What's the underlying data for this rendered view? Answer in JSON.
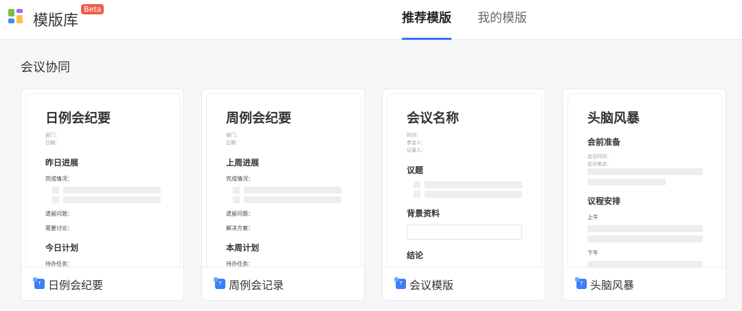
{
  "app": {
    "title": "模版库",
    "badge": "Beta"
  },
  "tabs": [
    {
      "label": "推荐模版",
      "active": true
    },
    {
      "label": "我的模版",
      "active": false
    }
  ],
  "section": {
    "title": "会议协同"
  },
  "colors": {
    "accent": "#3370ff",
    "badge": "#f25c4a"
  },
  "cards": [
    {
      "name": "日例会纪要",
      "blocks": [
        {
          "t": "title",
          "text": "日例会纪要"
        },
        {
          "t": "meta",
          "text": "部门："
        },
        {
          "t": "meta",
          "text": "日期："
        },
        {
          "t": "h2",
          "text": "昨日进展"
        },
        {
          "t": "label",
          "text": "完成情况："
        },
        {
          "t": "check"
        },
        {
          "t": "check"
        },
        {
          "t": "label",
          "text": "遗留问题："
        },
        {
          "t": "label",
          "text": "需要讨论："
        },
        {
          "t": "h2",
          "text": "今日计划"
        },
        {
          "t": "label",
          "text": "待办任务："
        }
      ]
    },
    {
      "name": "周例会记录",
      "blocks": [
        {
          "t": "title",
          "text": "周例会纪要"
        },
        {
          "t": "meta",
          "text": "部门："
        },
        {
          "t": "meta",
          "text": "日期："
        },
        {
          "t": "h2",
          "text": "上周进展"
        },
        {
          "t": "label",
          "text": "完成情况："
        },
        {
          "t": "check"
        },
        {
          "t": "check"
        },
        {
          "t": "label",
          "text": "遗留问题："
        },
        {
          "t": "label",
          "text": "解决方案："
        },
        {
          "t": "h2",
          "text": "本周计划"
        },
        {
          "t": "label",
          "text": "待办任务："
        }
      ]
    },
    {
      "name": "会议模版",
      "blocks": [
        {
          "t": "title",
          "text": "会议名称"
        },
        {
          "t": "meta",
          "text": "时间："
        },
        {
          "t": "meta",
          "text": "参会人："
        },
        {
          "t": "meta",
          "text": "记录人："
        },
        {
          "t": "h2",
          "text": "议题"
        },
        {
          "t": "check"
        },
        {
          "t": "check"
        },
        {
          "t": "h2",
          "text": "背景资料"
        },
        {
          "t": "box"
        },
        {
          "t": "h2",
          "text": "结论"
        }
      ]
    },
    {
      "name": "头脑风暴",
      "blocks": [
        {
          "t": "title",
          "text": "头脑风暴"
        },
        {
          "t": "h2",
          "text": "会前准备"
        },
        {
          "t": "meta",
          "text": "会议时间："
        },
        {
          "t": "meta",
          "text": "会议地点："
        },
        {
          "t": "bar"
        },
        {
          "t": "bar",
          "w": "short"
        },
        {
          "t": "h2",
          "text": "议程安排"
        },
        {
          "t": "label",
          "text": "上午"
        },
        {
          "t": "bar"
        },
        {
          "t": "bar"
        },
        {
          "t": "label",
          "text": "下午"
        },
        {
          "t": "bar"
        },
        {
          "t": "bar"
        }
      ]
    }
  ]
}
